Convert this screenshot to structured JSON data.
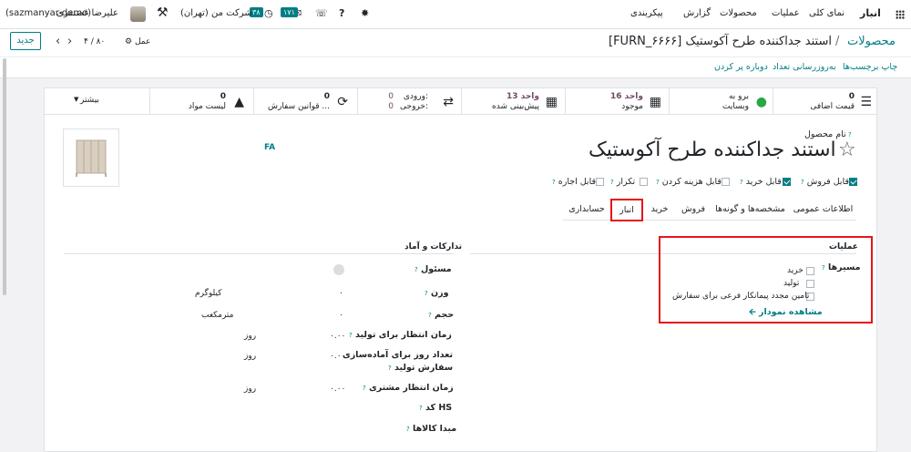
{
  "topbar": {
    "app_name": "انبار",
    "menu": [
      "نمای کلی",
      "عملیات",
      "محصولات",
      "گزارش",
      "پیکربندی"
    ],
    "company": "شرکت من (تهران)",
    "badge_activity": "۳۸",
    "badge_messages": "۱۷۱",
    "user_name": "علیرضا غضنفری",
    "database": "(sazmanyar-demo)"
  },
  "breadcrumb": {
    "parent": "محصولات",
    "separator": "/",
    "current": "[FURN_۶۶۶۶] استند جداکننده طرح آکوستیک",
    "gear_label": "عمل",
    "pager": "۴ / ۸۰",
    "new_button": "جدید"
  },
  "actions": [
    "چاپ برچسب‌ها",
    "به‌روزرسانی تعداد",
    "دوباره پر کردن"
  ],
  "smart_buttons": {
    "extra_price": {
      "value": "0",
      "label": "قیمت اضافی"
    },
    "website": {
      "line1": "برو به",
      "line2": "وبسایت"
    },
    "on_hand": {
      "value": "16 واحد",
      "label": "موجود"
    },
    "forecast": {
      "value": "13 واحد",
      "label": "پیش‌بینی شده"
    },
    "in_out": {
      "in_label": "ورودی:",
      "in_value": "0",
      "out_label": "خروجی:",
      "out_value": "0"
    },
    "rules": {
      "value": "0",
      "label": "قوانین سفارش ..."
    },
    "bom": {
      "value": "0",
      "label": "لیست مواد"
    },
    "more": "بیشتر"
  },
  "product": {
    "name_label": "نام محصول",
    "name": "استند جداکننده طرح آکوستیک",
    "lang": "FA"
  },
  "flags": [
    {
      "label": "قابل فروش",
      "checked": true
    },
    {
      "label": "قابل خرید",
      "checked": true
    },
    {
      "label": "قابل هزینه کردن",
      "checked": false
    },
    {
      "label": "تکرار",
      "checked": false
    },
    {
      "label": "قابل اجاره",
      "checked": false
    }
  ],
  "tabs": [
    "اطلاعات عمومی",
    "مشخصه‌ها و گونه‌ها",
    "فروش",
    "خرید",
    "انبار",
    "حسابداری"
  ],
  "active_tab": "انبار",
  "operations": {
    "title": "عملیات",
    "routes_label": "مسیرها",
    "routes": [
      "خرید",
      "تولید",
      "تامین مجدد پیمانکار فرعی برای سفارش"
    ],
    "diagram_link": "مشاهده نمودار"
  },
  "logistics": {
    "title": "تدارکات و آماد",
    "responsible_label": "مسئول",
    "weight_label": "وزن",
    "weight_value": "۰",
    "weight_unit": "کیلوگرم",
    "volume_label": "حجم",
    "volume_value": "۰",
    "volume_unit": "مترمکعب",
    "mfg_lead_label": "زمان انتظار برای تولید",
    "mfg_lead_value": "۰.۰۰",
    "mfg_prep_label_1": "تعداد روز برای آماده‌سازی",
    "mfg_prep_label_2": "سفارش تولید",
    "mfg_prep_value": "۰.۰۰",
    "customer_lead_label": "زمان انتظار مشتری",
    "customer_lead_value": "۰.۰۰",
    "day_unit": "روز",
    "hs_label": "کد HS",
    "origin_label": "مبدا کالاها"
  },
  "colors": {
    "accent": "#017e84",
    "brand": "#714b67",
    "highlight": "#e5151a"
  }
}
